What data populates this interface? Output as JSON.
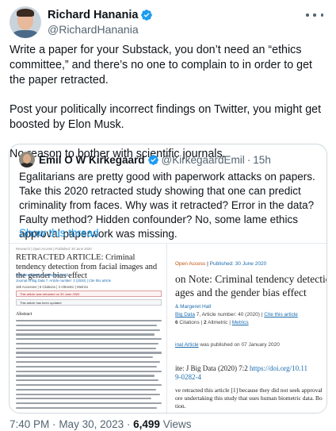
{
  "author": {
    "display_name": "Richard Hanania",
    "handle": "@RichardHanania"
  },
  "tweet": {
    "paragraphs": [
      "Write a paper for your Substack, you don’t need an “ethics committee,” and there’s no one to complain to in order to get the paper retracted.",
      "Post your politically incorrect findings on Twitter, you might get boosted by Elon Musk.",
      "No reason to bother with scientific journals."
    ]
  },
  "quote": {
    "display_name": "Emil O W Kirkegaard",
    "handle": "@KirkegaardEmil",
    "separator": "·",
    "time": "15h",
    "text": "Egalitarians are pretty good with paperwork attacks on papers. Take this 2020 retracted study showing that one can predict criminality from faces. Why was it retracted? Error in the data? Faulty method? Hidden confounder? No, some lame ethics approval paperwork was missing.",
    "show_thread": "Show this thread"
  },
  "media_left": {
    "top": "Research | Open Access | Published: 30 June 2020",
    "title": "RETRACTED ARTICLE: Criminal tendency detection from facial images and the gender bias effect",
    "authors": "Mahdi Hashemi ✉ & Margeret Hall",
    "journal": "Journal of Big Data 7, Article number: 2 (2020) | Cite this article",
    "stats": "16k Accesses | 6 Citations | 2 Altmetric | Metrics",
    "banner_retracted": "This article was retracted on 30 June 2020",
    "banner_updated": "This article has been updated",
    "abstract_heading": "Abstract"
  },
  "media_right": {
    "top_oa": "Open Access",
    "top_sep": " | ",
    "top_pub": "Published: 30 June 2020",
    "title_line1": "on Note: Criminal tendency detection",
    "title_line2": "ages and the gender bias effect",
    "authors": "& Margeret Hall",
    "journal_link": "Big Data",
    "journal_rest": " 7, Article number: 40 (2020) | ",
    "journal_cite": "Cite this article",
    "stats_citations": "6",
    "stats_citations_label": " Citations | ",
    "stats_altmetric": "2",
    "stats_altmetric_label": " Altmetric | ",
    "stats_metrics": "Metrics",
    "notice_link": "inal Article",
    "notice_rest": " was published on 07 January 2020",
    "cite_prefix": "ite: J Big Data (2020) 7:2 ",
    "cite_doi": "https://doi.org/10.11",
    "cite_line2": "9-0282-4",
    "body_line1": "ve retracted this article [1] because they did not seek approval",
    "body_line2": "ore undertaking this study that uses human biometric data. Bo",
    "body_line3": "tion."
  },
  "footer": {
    "time": "7:40 PM",
    "separator": "·",
    "date": "May 30, 2023",
    "views_count": "6,499",
    "views_label": "Views"
  },
  "colors": {
    "accent": "#1d9bf0",
    "text": "#0f1419",
    "muted": "#536471",
    "border": "#cfd9de"
  }
}
